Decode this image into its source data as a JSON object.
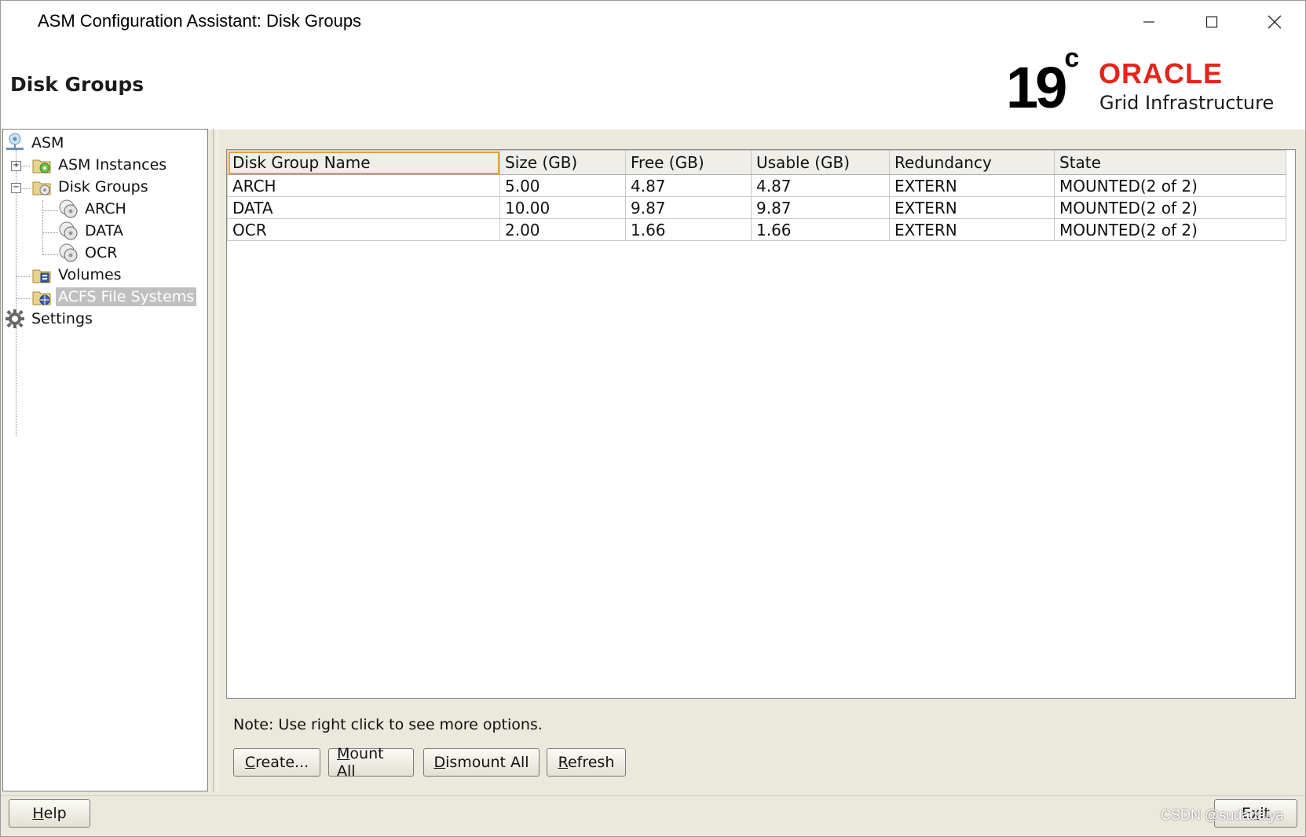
{
  "window": {
    "title": "ASM Configuration Assistant: Disk Groups"
  },
  "header": {
    "page_title": "Disk Groups",
    "logo": {
      "version": "19",
      "version_sup": "c",
      "brand": "ORACLE",
      "product": "Grid Infrastructure"
    }
  },
  "tree": {
    "root": "ASM",
    "items": [
      {
        "label": "ASM Instances",
        "icon": "asm-instances-icon"
      },
      {
        "label": "Disk Groups",
        "icon": "disk-groups-folder-icon"
      },
      {
        "label": "ARCH",
        "icon": "disk-icon"
      },
      {
        "label": "DATA",
        "icon": "disk-icon"
      },
      {
        "label": "OCR",
        "icon": "disk-icon"
      },
      {
        "label": "Volumes",
        "icon": "volumes-folder-icon"
      },
      {
        "label": "ACFS File Systems",
        "icon": "acfs-folder-icon"
      }
    ],
    "settings": "Settings"
  },
  "table": {
    "columns": [
      "Disk Group Name",
      "Size (GB)",
      "Free (GB)",
      "Usable (GB)",
      "Redundancy",
      "State"
    ],
    "rows": [
      [
        "ARCH",
        "5.00",
        "4.87",
        "4.87",
        "EXTERN",
        "MOUNTED(2 of 2)"
      ],
      [
        "DATA",
        "10.00",
        "9.87",
        "9.87",
        "EXTERN",
        "MOUNTED(2 of 2)"
      ],
      [
        "OCR",
        "2.00",
        "1.66",
        "1.66",
        "EXTERN",
        "MOUNTED(2 of 2)"
      ]
    ]
  },
  "note": "Note: Use right click to see more options.",
  "buttons": {
    "create": {
      "mnemonic": "C",
      "rest": "reate..."
    },
    "mount_all": {
      "mnemonic": "M",
      "rest": "ount All"
    },
    "dismount_all": {
      "mnemonic": "D",
      "rest": "ismount All"
    },
    "refresh": {
      "mnemonic": "R",
      "rest": "efresh"
    },
    "help": {
      "mnemonic": "H",
      "rest": "elp"
    },
    "exit": {
      "pre": "E",
      "mnemonic": "x",
      "rest": "it"
    }
  },
  "watermark": "CSDN @sudadaiya"
}
